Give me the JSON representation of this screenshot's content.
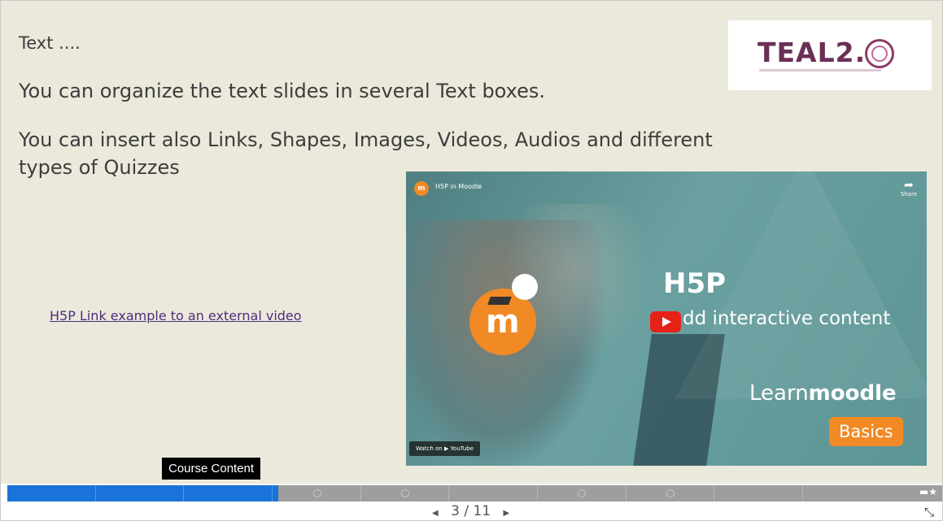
{
  "slide": {
    "line1": "Text ....",
    "line2": "You can organize the text slides in several Text boxes.",
    "line3": "You can insert also Links, Shapes, Images, Videos, Audios and different types of Quizzes",
    "link_text": "H5P Link example to an external video"
  },
  "logo": {
    "text": "TEAL2."
  },
  "video": {
    "channel_title": "H5P in Moodle",
    "share_label": "Share",
    "heading": "H5P",
    "subtitle": "dd interactive content",
    "learn_text": "Learn",
    "learn_brand": "moodle",
    "badge": "Basics",
    "watch_on": "Watch on ▶ YouTube"
  },
  "tooltip": {
    "text": "Course Content"
  },
  "progress": {
    "current": 3,
    "total": 11,
    "fill_fraction": 0.29
  },
  "pager": {
    "prev": "◀",
    "label": "3 / 11",
    "next": "▶"
  },
  "colors": {
    "slide_bg": "#ebe9db",
    "progress_fill": "#1a73d9",
    "accent_orange": "#f18a25"
  },
  "icons": {
    "fullscreen": "fullscreen-exit-icon",
    "play": "youtube-play-icon",
    "share": "share-icon"
  }
}
